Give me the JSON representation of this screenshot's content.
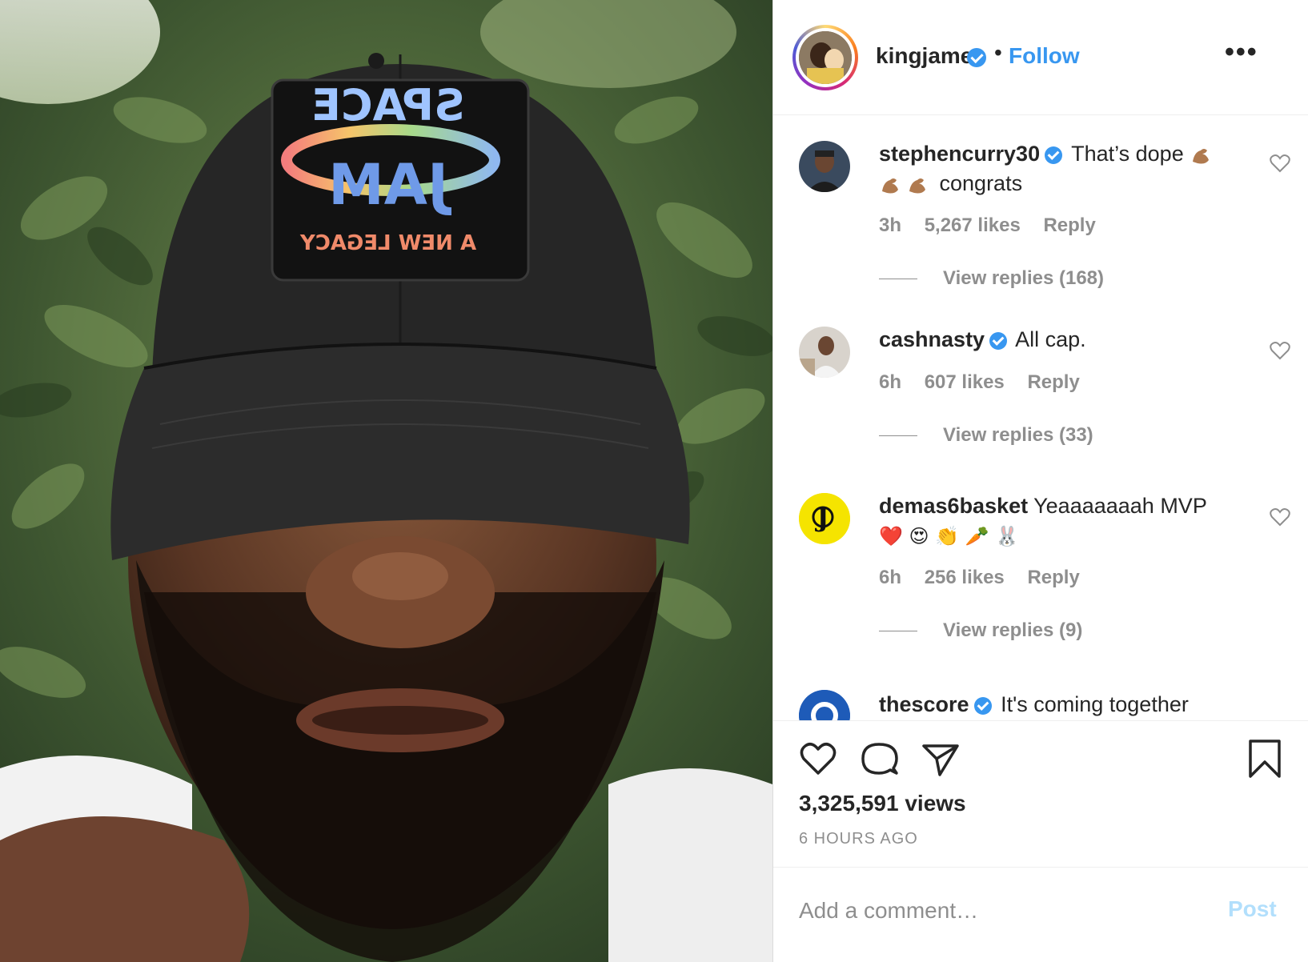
{
  "post": {
    "author": "kingjames",
    "follow_label": "Follow",
    "dot": "•",
    "more_label": "•••",
    "views": "3,325,591 views",
    "time_ago": "6 HOURS AGO"
  },
  "comments": [
    {
      "user": "stephencurry30",
      "verified": true,
      "text": "That’s dope",
      "text_after": "congrats",
      "emoji_names": [
        "flexed-biceps",
        "flexed-biceps",
        "flexed-biceps"
      ],
      "age": "3h",
      "likes": "5,267 likes",
      "reply_label": "Reply",
      "view_replies": "View replies (168)"
    },
    {
      "user": "cashnasty",
      "verified": true,
      "text": "All cap.",
      "age": "6h",
      "likes": "607 likes",
      "reply_label": "Reply",
      "view_replies": "View replies (33)"
    },
    {
      "user": "demas6basket",
      "verified": false,
      "text": "Yeaaaaaaah MVP",
      "emoji_line": "❤️ 😍 👏 🥕 🐰",
      "age": "6h",
      "likes": "256 likes",
      "reply_label": "Reply",
      "view_replies": "View replies (9)"
    },
    {
      "user": "thescore",
      "verified": true,
      "text": "It's coming together"
    }
  ],
  "comment_box": {
    "placeholder": "Add a comment…",
    "post_label": "Post"
  },
  "media": {
    "cap_patch_lines": [
      "SPACE",
      "JAM",
      "A NEW LEGACY"
    ]
  },
  "colors": {
    "link": "#3897f0",
    "muted": "#8e8e8e",
    "post_disabled": "#b2dffc",
    "text": "#262626"
  },
  "icons": [
    "verified-badge-icon",
    "heart-icon",
    "comment-icon",
    "share-icon",
    "bookmark-icon",
    "more-icon"
  ]
}
